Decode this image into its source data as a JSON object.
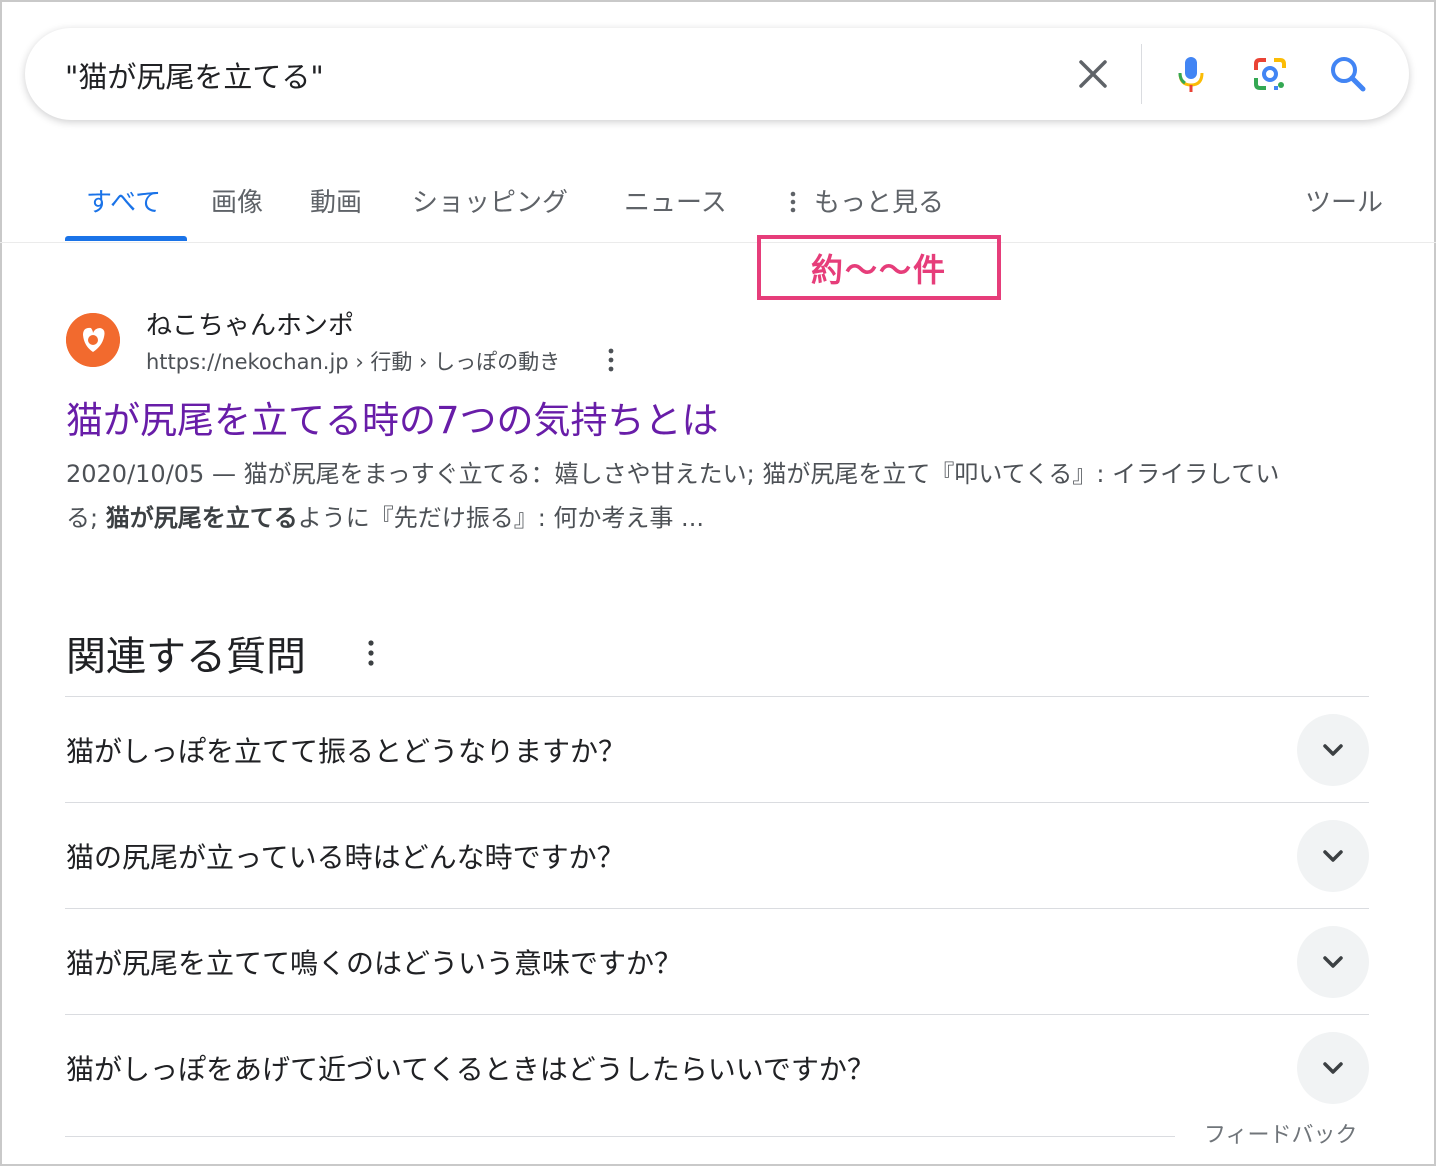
{
  "search": {
    "query": "\"猫が尻尾を立てる\""
  },
  "tabs": [
    {
      "label": "すべて",
      "active": true
    },
    {
      "label": "画像"
    },
    {
      "label": "動画"
    },
    {
      "label": "ショッピング"
    },
    {
      "label": "ニュース"
    },
    {
      "label": "もっと見る"
    },
    {
      "label": "ツール"
    }
  ],
  "annotation": {
    "text": "約〜〜件",
    "color": "#e63d7a"
  },
  "result": {
    "site_name": "ねこちゃんホンポ",
    "url": "https://nekochan.jp › 行動 › しっぽの動き",
    "title": "猫が尻尾を立てる時の7つの気持ちとは",
    "snippet_part1": "2020/10/05 — 猫が尻尾をまっすぐ立てる：嬉しさや甘えたい; 猫が尻尾を立て『叩いてくる』: イライラしている; ",
    "snippet_bold": "猫が尻尾を立てる",
    "snippet_part2": "ように『先だけ振る』: 何か考え事 ..."
  },
  "paa": {
    "title": "関連する質問",
    "questions": [
      "猫がしっぽを立てて振るとどうなりますか？",
      "猫の尻尾が立っている時はどんな時ですか？",
      "猫が尻尾を立てて鳴くのはどういう意味ですか？",
      "猫がしっぽをあげて近づいてくるときはどうしたらいいですか？"
    ]
  },
  "feedback": "フィードバック",
  "colors": {
    "accent": "#1a73e8",
    "visited_link": "#681da8",
    "annotation": "#e63d7a",
    "favicon": "#f26a2e"
  }
}
